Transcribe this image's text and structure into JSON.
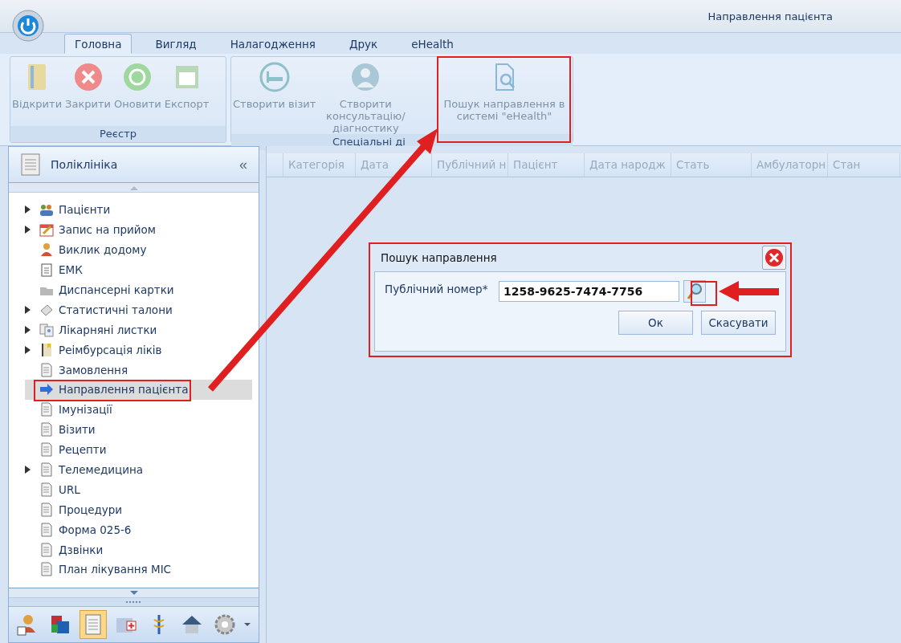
{
  "window": {
    "title": "Направлення пацієнта"
  },
  "tabs": [
    {
      "label": "Головна",
      "selected": true
    },
    {
      "label": "Вигляд",
      "selected": false
    },
    {
      "label": "Налагодження",
      "selected": false
    },
    {
      "label": "Друк",
      "selected": false
    },
    {
      "label": "eHealth",
      "selected": false
    }
  ],
  "ribbon": {
    "groups": [
      {
        "title": "Реєстр",
        "buttons": [
          {
            "label": "Відкрити",
            "kind": "folder",
            "disabled": true
          },
          {
            "label": "Закрити",
            "kind": "close",
            "disabled": true
          },
          {
            "label": "Оновити",
            "kind": "refresh",
            "disabled": true
          },
          {
            "label": "Експорт",
            "kind": "sheet",
            "disabled": true
          }
        ]
      },
      {
        "title": "Спеціальні ді",
        "buttons": [
          {
            "label": "Створити візит",
            "kind": "bed",
            "disabled": true
          },
          {
            "label": "Створити консультацію/діагностику",
            "kind": "doctor",
            "disabled": true
          },
          {
            "label": "Пошук направлення в системі \"eHealth\"",
            "kind": "docsearch",
            "disabled": true
          }
        ]
      }
    ]
  },
  "sidebar": {
    "title": "Поліклініка",
    "collapse": "«",
    "items": [
      {
        "label": "Пацієнти",
        "expandable": true,
        "selected": false
      },
      {
        "label": "Запис на прийом",
        "expandable": true,
        "selected": false
      },
      {
        "label": "Виклик додому",
        "expandable": false,
        "selected": false
      },
      {
        "label": "ЕМК",
        "expandable": false,
        "selected": false
      },
      {
        "label": "Диспансерні картки",
        "expandable": false,
        "selected": false
      },
      {
        "label": "Статистичні талони",
        "expandable": true,
        "selected": false
      },
      {
        "label": "Лікарняні листки",
        "expandable": true,
        "selected": false
      },
      {
        "label": "Реімбурсація ліків",
        "expandable": true,
        "selected": false
      },
      {
        "label": "Замовлення",
        "expandable": false,
        "selected": false
      },
      {
        "label": "Направлення пацієнта",
        "expandable": false,
        "selected": true
      },
      {
        "label": "Імунізації",
        "expandable": false,
        "selected": false
      },
      {
        "label": "Візити",
        "expandable": false,
        "selected": false
      },
      {
        "label": "Рецепти",
        "expandable": false,
        "selected": false
      },
      {
        "label": "Телемедицина",
        "expandable": true,
        "selected": false
      },
      {
        "label": "URL",
        "expandable": false,
        "selected": false
      },
      {
        "label": "Процедури",
        "expandable": false,
        "selected": false
      },
      {
        "label": "Форма 025-6",
        "expandable": false,
        "selected": false
      },
      {
        "label": "Дзвінки",
        "expandable": false,
        "selected": false
      },
      {
        "label": "План лікування МІС",
        "expandable": false,
        "selected": false
      }
    ],
    "bottom_buttons": [
      {
        "selected": false
      },
      {
        "selected": false
      },
      {
        "selected": true
      },
      {
        "selected": false
      },
      {
        "selected": false
      },
      {
        "selected": false
      },
      {
        "selected": false
      }
    ]
  },
  "table": {
    "columns": [
      "Категорія",
      "Дата",
      "Публічний н",
      "Пацієнт",
      "Дата народж",
      "Стать",
      "Амбулаторн",
      "Стан"
    ]
  },
  "dialog": {
    "title": "Пошук направлення",
    "field_label": "Публічний номер*",
    "field_value": "1258-9625-7474-7756",
    "buttons": [
      "Ок",
      "Скасувати"
    ]
  }
}
